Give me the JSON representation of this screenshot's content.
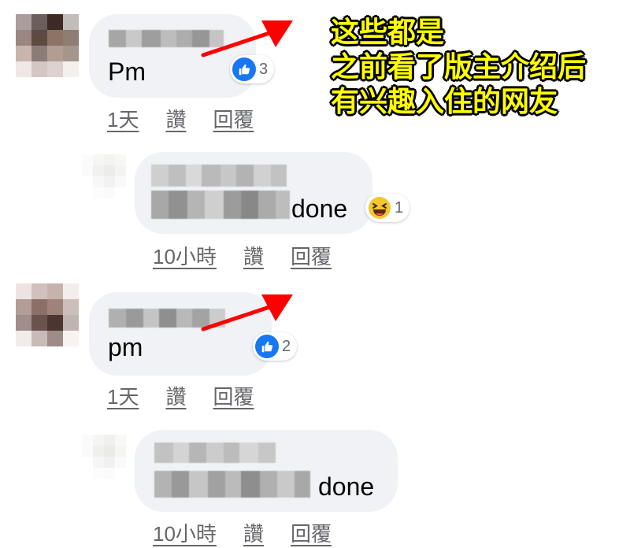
{
  "annotation": {
    "lines": [
      "这些都是",
      "之前看了版主介绍后",
      "有兴趣入住的网友"
    ],
    "color": "#ffff00"
  },
  "comments": [
    {
      "text": "Pm",
      "reaction": {
        "type": "like-icon",
        "count": "3"
      },
      "actions": {
        "time": "1天",
        "like": "讚",
        "reply": "回覆"
      },
      "replies": [
        {
          "text": "done",
          "reaction": {
            "type": "haha-icon",
            "count": "1"
          },
          "actions": {
            "time": "10小時",
            "like": "讚",
            "reply": "回覆"
          }
        }
      ]
    },
    {
      "text": "pm",
      "reaction": {
        "type": "like-icon",
        "count": "2"
      },
      "actions": {
        "time": "1天",
        "like": "讚",
        "reply": "回覆"
      },
      "replies": [
        {
          "text": "done",
          "actions": {
            "time": "10小時",
            "like": "讚",
            "reply": "回覆"
          }
        }
      ]
    }
  ],
  "colors": {
    "like": "#1877f2",
    "bubble": "#f0f2f5",
    "arrow": "#ff0000",
    "action_text": "#65676b"
  }
}
